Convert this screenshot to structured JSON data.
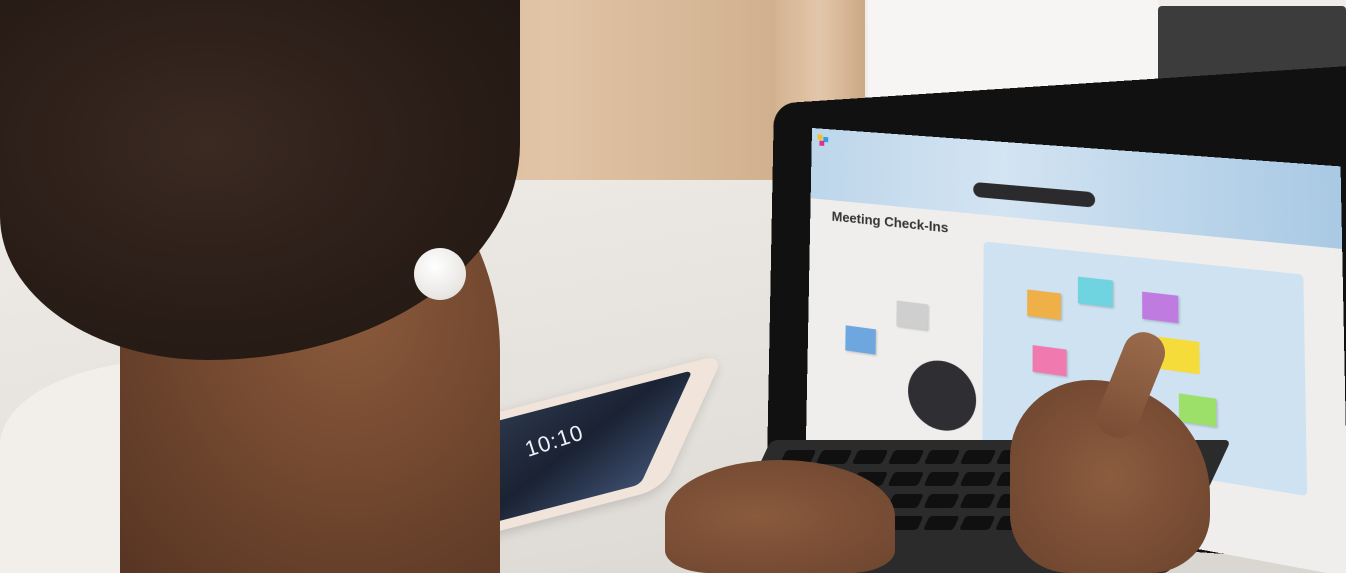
{
  "phone": {
    "time": "10:10"
  },
  "screen": {
    "title": "Meeting Check-Ins",
    "colors": {
      "sticky_orange": "#f0b048",
      "sticky_cyan": "#6fd3e0",
      "sticky_purple": "#c07be0",
      "sticky_pink": "#f07ab0",
      "sticky_yellow": "#f6dc3a",
      "sticky_green": "#9ce06a",
      "sticky_blue": "#2f6fc8",
      "toolbar": "#2b2b2e",
      "board": "#cfe2f1"
    }
  }
}
